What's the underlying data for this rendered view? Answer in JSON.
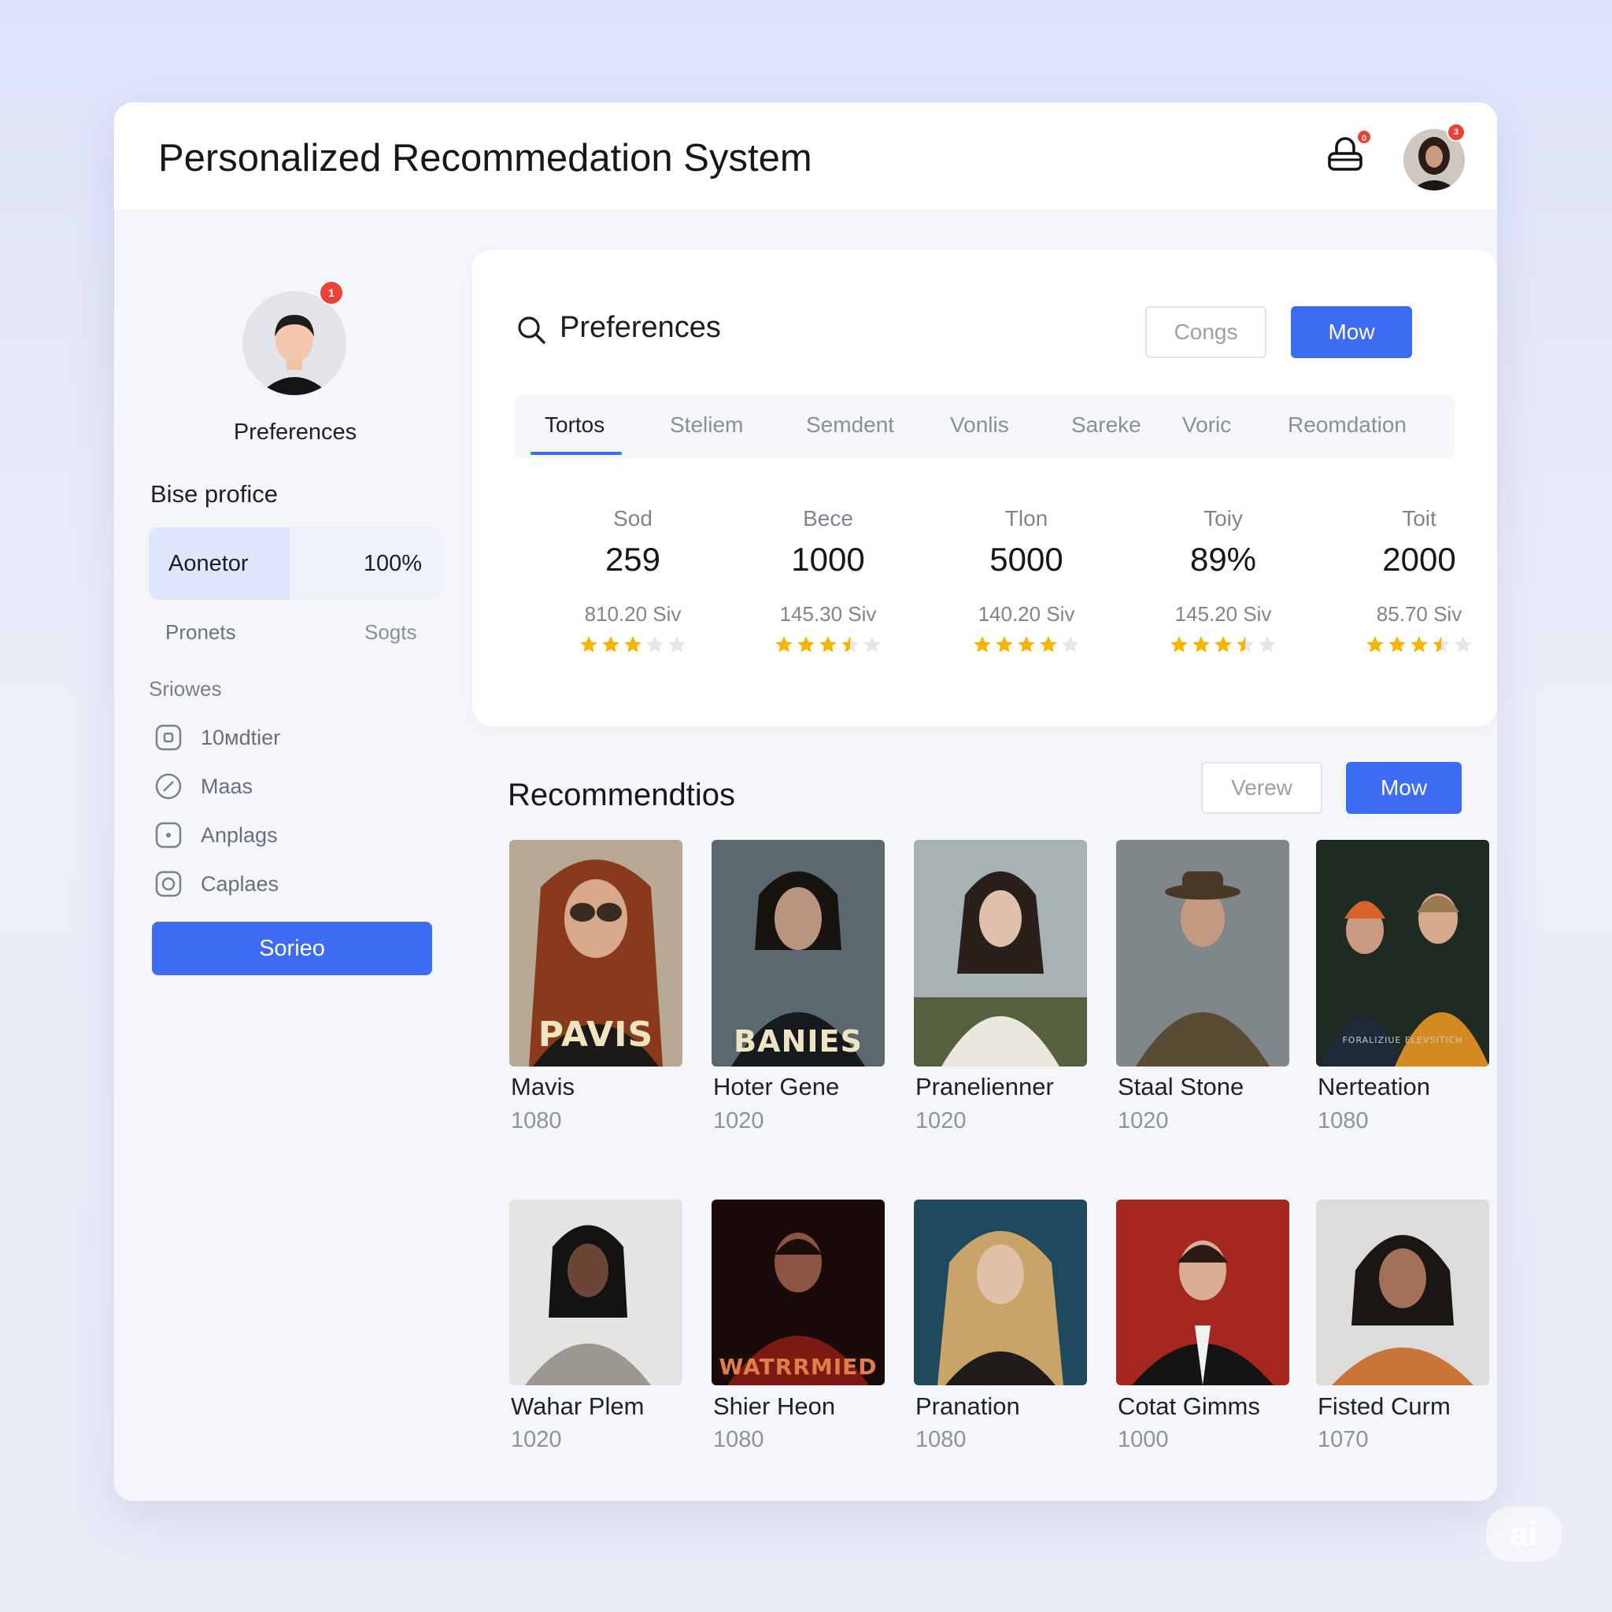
{
  "app": {
    "title": "Personalized Recommedation System"
  },
  "header": {
    "notification_badge": "0",
    "avatar_badge": "3"
  },
  "sidebar": {
    "profile_badge": "1",
    "profile_label": "Preferences",
    "base_profile_label": "Bise profice",
    "progress": {
      "name": "Aonetor",
      "value_text": "100%",
      "fill_fraction": 0.48
    },
    "sub_left": "Pronets",
    "sub_right": "Sogts",
    "section_label": "Sriowes",
    "items": [
      {
        "label": "10мdtier",
        "icon": "square-icon"
      },
      {
        "label": "Maas",
        "icon": "edit-icon"
      },
      {
        "label": "Anplags",
        "icon": "dot-square-icon"
      },
      {
        "label": "Caplaes",
        "icon": "check-square-icon"
      }
    ],
    "button_label": "Sorieo"
  },
  "preferences": {
    "title": "Preferences",
    "secondary_button": "Congs",
    "primary_button": "Mow",
    "tabs": [
      "Tortos",
      "Steliem",
      "Semdent",
      "Vonlis",
      "Sareke",
      "Voric",
      "Reomdation"
    ],
    "active_tab": 0,
    "stats": [
      {
        "label": "Sod",
        "value": "259",
        "sub": "810.20 Siv",
        "rating": 3
      },
      {
        "label": "Bece",
        "value": "1000",
        "sub": "145.30 Siv",
        "rating": 3.5
      },
      {
        "label": "Tlon",
        "value": "5000",
        "sub": "140.20 Siv",
        "rating": 4
      },
      {
        "label": "Toiy",
        "value": "89%",
        "sub": "145.20 Siv",
        "rating": 3.5
      },
      {
        "label": "Toit",
        "value": "2000",
        "sub": "85.70 Siv",
        "rating": 3.5
      }
    ]
  },
  "recommendations": {
    "title": "Recommendtios",
    "secondary_button": "Verew",
    "primary_button": "Mow",
    "items": [
      {
        "name": "Mavis",
        "year": "1080",
        "poster_text": "PAVIS"
      },
      {
        "name": "Hoter Gene",
        "year": "1020",
        "poster_text": "BANIES"
      },
      {
        "name": "Pranelienner",
        "year": "1020",
        "poster_text": ""
      },
      {
        "name": "Staal Stone",
        "year": "1020",
        "poster_text": ""
      },
      {
        "name": "Nerteation",
        "year": "1080",
        "poster_text": "FORALIZIUE ELEVSITICH"
      },
      {
        "name": "Wahar Plem",
        "year": "1020",
        "poster_text": ""
      },
      {
        "name": "Shier Heon",
        "year": "1080",
        "poster_text": "WATRRMIED"
      },
      {
        "name": "Pranation",
        "year": "1080",
        "poster_text": ""
      },
      {
        "name": "Cotat Gimms",
        "year": "1000",
        "poster_text": ""
      },
      {
        "name": "Fisted Curm",
        "year": "1070",
        "poster_text": ""
      }
    ]
  },
  "watermark": "ai",
  "colors": {
    "accent": "#3d6bf2",
    "star": "#f5b400",
    "star_empty": "#e3e5e9",
    "badge": "#ea4335"
  }
}
